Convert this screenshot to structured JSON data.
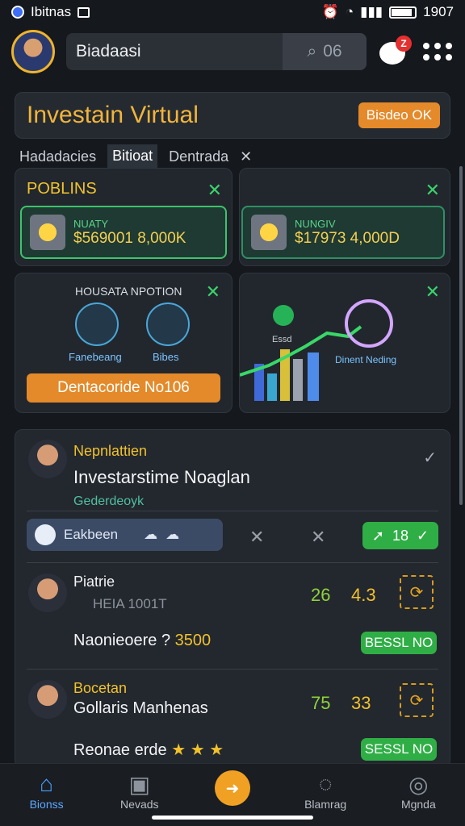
{
  "status": {
    "carrier": "Ibitnas",
    "time": "1907"
  },
  "header": {
    "search_text": "Biadaasi",
    "search_count": "06",
    "notification_count": "Z"
  },
  "hero": {
    "title": "Investain Virtual",
    "badge": "Bisdeo OK"
  },
  "tabs": [
    "Hadadacies",
    "Bitioat",
    "Dentrada"
  ],
  "cards": {
    "points": {
      "title": "POBLINS",
      "left_label": "NUATY",
      "left_value": "$569001 8,000K",
      "right_label": "NUNGIV",
      "right_value": "$17973 4,000D"
    },
    "features": {
      "title": "HOUSATA NPOTION",
      "item1": "Fanebeang",
      "item2": "Bibes",
      "button": "Dentacoride No106"
    },
    "growth": {
      "label1": "Essd",
      "label2": "Dinent Neding"
    }
  },
  "feed": {
    "post1": {
      "user": "Nepnlattien",
      "headline": "Investarstime Noaglan",
      "sub": "Gederdeoyk",
      "action": "Eakbeen",
      "pill": "18"
    },
    "post2": {
      "user": "Piatrie",
      "meta": "HEIA 1001T",
      "m1": "26",
      "m2": "4.3",
      "amount_label": "Naonieoere ?",
      "amount": "3500",
      "tag": "BESSL NO"
    },
    "post3": {
      "user": "Bocetan",
      "name": "Gollaris Manhenas",
      "m1": "75",
      "m2": "33",
      "amount_label": "Reonae erde",
      "tag": "SESSL NO"
    }
  },
  "nav": [
    "Bionss",
    "Nevads",
    "",
    "Blamrag",
    "Mgnda"
  ]
}
